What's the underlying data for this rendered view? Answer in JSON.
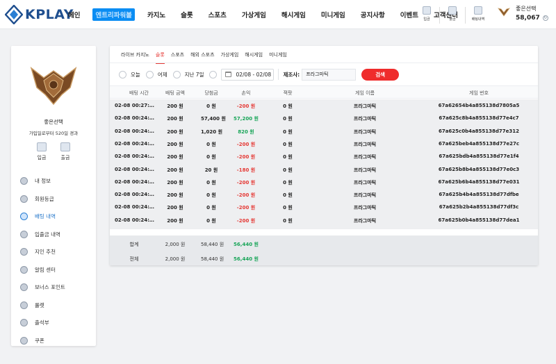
{
  "brand": {
    "name": "KPLAY",
    "color": "#1f4f8f"
  },
  "nav": [
    "메인",
    "엔트리파워볼",
    "카지노",
    "슬롯",
    "스포츠",
    "가상게임",
    "해시게임",
    "미니게임",
    "공지사항",
    "이벤트",
    "고객센터"
  ],
  "nav_active_index": 1,
  "header_icons": [
    "입금",
    "출금",
    "배팅내역"
  ],
  "user": {
    "name": "좋은선택",
    "balance": "58,067"
  },
  "sidebar": {
    "name": "좋은선택",
    "subtitle": "가입일로부터 520일 경과",
    "quick": [
      "입금",
      "출금"
    ],
    "menu": [
      "내 정보",
      "회원등급",
      "배팅 내역",
      "입출금 내역",
      "지인 추천",
      "알림 센터",
      "보너스 포인트",
      "룰렛",
      "출석부",
      "쿠폰"
    ],
    "active_index": 2
  },
  "tabs": [
    "라이브 카지노",
    "슬롯",
    "스포츠",
    "해외 스포츠",
    "가상게임",
    "해시게임",
    "미니게임"
  ],
  "tab_active_index": 1,
  "filters": {
    "options": [
      "오늘",
      "어제",
      "지난 7일"
    ],
    "date_range": "02/08 - 02/08",
    "provider_label": "제조사:",
    "provider_value": "프라그마틱",
    "search_label": "검색"
  },
  "table": {
    "headers": [
      "배팅 시간",
      "배팅 금액",
      "당첨금",
      "손익",
      "잭팟",
      "게임 이름",
      "게임 번호"
    ],
    "rows": [
      {
        "time": "02-08 00:27:…",
        "bet": "200 원",
        "win": "0 원",
        "pl": "-200 원",
        "pl_sign": "neg",
        "jackpot": "0 원",
        "game": "프라그마틱",
        "id": "67a62654b4a855138d7805a5"
      },
      {
        "time": "02-08 00:24:…",
        "bet": "200 원",
        "win": "57,400 원",
        "pl": "57,200 원",
        "pl_sign": "pos",
        "jackpot": "0 원",
        "game": "프라그마틱",
        "id": "67a625c8b4a855138d77e4c7"
      },
      {
        "time": "02-08 00:24:…",
        "bet": "200 원",
        "win": "1,020 원",
        "pl": "820 원",
        "pl_sign": "pos",
        "jackpot": "0 원",
        "game": "프라그마틱",
        "id": "67a625c0b4a855138d77e312"
      },
      {
        "time": "02-08 00:24:…",
        "bet": "200 원",
        "win": "0 원",
        "pl": "-200 원",
        "pl_sign": "neg",
        "jackpot": "0 원",
        "game": "프라그마틱",
        "id": "67a625beb4a855138d77e27c"
      },
      {
        "time": "02-08 00:24:…",
        "bet": "200 원",
        "win": "0 원",
        "pl": "-200 원",
        "pl_sign": "neg",
        "jackpot": "0 원",
        "game": "프라그마틱",
        "id": "67a625bdb4a855138d77e1f4"
      },
      {
        "time": "02-08 00:24:…",
        "bet": "200 원",
        "win": "20 원",
        "pl": "-180 원",
        "pl_sign": "neg",
        "jackpot": "0 원",
        "game": "프라그마틱",
        "id": "67a625b8b4a855138d77e0c3"
      },
      {
        "time": "02-08 00:24:…",
        "bet": "200 원",
        "win": "0 원",
        "pl": "-200 원",
        "pl_sign": "neg",
        "jackpot": "0 원",
        "game": "프라그마틱",
        "id": "67a625b6b4a855138d77e031"
      },
      {
        "time": "02-08 00:24:…",
        "bet": "200 원",
        "win": "0 원",
        "pl": "-200 원",
        "pl_sign": "neg",
        "jackpot": "0 원",
        "game": "프라그마틱",
        "id": "67a625b4b4a855138d77dfbe"
      },
      {
        "time": "02-08 00:24:…",
        "bet": "200 원",
        "win": "0 원",
        "pl": "-200 원",
        "pl_sign": "neg",
        "jackpot": "0 원",
        "game": "프라그마틱",
        "id": "67a625b2b4a855138d77df3c"
      },
      {
        "time": "02-08 00:24:…",
        "bet": "200 원",
        "win": "0 원",
        "pl": "-200 원",
        "pl_sign": "neg",
        "jackpot": "0 원",
        "game": "프라그마틱",
        "id": "67a625b0b4a855138d77dea1"
      }
    ],
    "totals": [
      {
        "label": "합계",
        "bet": "2,000 원",
        "win": "58,440 원",
        "pl": "56,440 원"
      },
      {
        "label": "전체",
        "bet": "2,000 원",
        "win": "58,440 원",
        "pl": "56,440 원"
      }
    ]
  },
  "colors": {
    "accent": "#e53935",
    "positive": "#18a558",
    "nav_active": "#0b8df3"
  }
}
